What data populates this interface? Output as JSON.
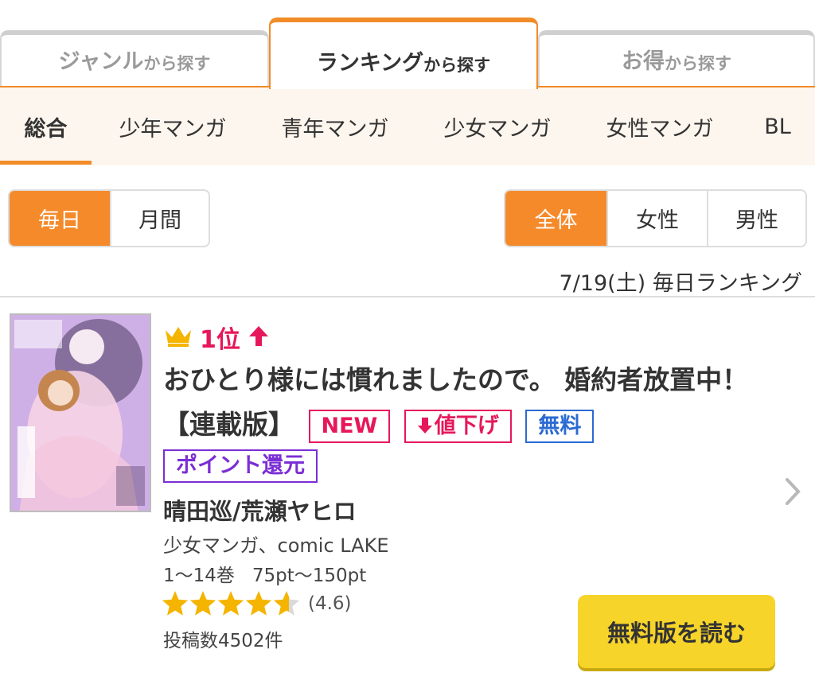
{
  "top_tabs": [
    {
      "main": "ジャンル",
      "suffix": "から探す"
    },
    {
      "main": "ランキング",
      "suffix": "から探す"
    },
    {
      "main": "お得",
      "suffix": "から探す"
    }
  ],
  "categories": [
    "総合",
    "少年マンガ",
    "青年マンガ",
    "少女マンガ",
    "女性マンガ",
    "BL"
  ],
  "period_toggle": [
    "毎日",
    "月間"
  ],
  "audience_toggle": [
    "全体",
    "女性",
    "男性"
  ],
  "ranking_date": "7/19(土) 毎日ランキング",
  "item": {
    "rank": "1位",
    "title": "おひとり様には慣れましたので。 婚約者放置中！ 【連載版】",
    "badges": {
      "new": "NEW",
      "price_down": "値下げ",
      "free": "無料",
      "point": "ポイント還元"
    },
    "author": "晴田巡/荒瀬ヤヒロ",
    "genre": "少女マンガ、comic LAKE",
    "volumes": "1〜14巻   75pt〜150pt",
    "rating": 4.6,
    "rating_text": "(4.6)",
    "reviews": "投稿数4502件",
    "read_button": "無料版を読む"
  },
  "colors": {
    "accent": "#f28c28",
    "rank": "#e6185b",
    "free": "#2b6ad2",
    "point": "#7b2ed6",
    "button": "#f7d429"
  },
  "icons": [
    "crown-icon",
    "rank-up-arrow-icon",
    "down-arrow-icon",
    "star-icon",
    "chevron-right-icon"
  ]
}
